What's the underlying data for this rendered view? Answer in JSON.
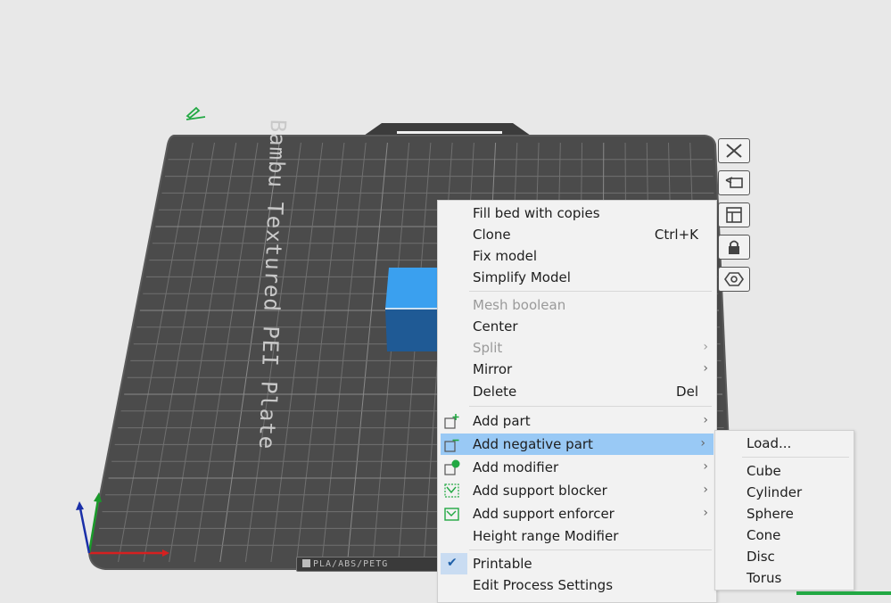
{
  "viewport": {
    "plate_label": "Bambu Textured PEI Plate",
    "plate_badge": "PLA/ABS/PETG",
    "colors": {
      "plate": "#4b4b4b",
      "grid": "#6e6e6e",
      "cube_top": "#3aa0ef",
      "cube_side": "#1f5a95",
      "axis_x": "#d62020",
      "axis_y": "#1a9a2a",
      "axis_z": "#1a2fa8"
    }
  },
  "toolbar_right": {
    "icons": [
      "close-icon",
      "arrange-icon",
      "layout-icon",
      "lock-icon",
      "hexagon-icon"
    ]
  },
  "context_menu": {
    "fill_bed": "Fill bed with copies",
    "clone": "Clone",
    "clone_shortcut": "Ctrl+K",
    "fix_model": "Fix model",
    "simplify_model": "Simplify Model",
    "mesh_boolean": "Mesh boolean",
    "center": "Center",
    "split": "Split",
    "mirror": "Mirror",
    "delete": "Delete",
    "delete_shortcut": "Del",
    "add_part": "Add part",
    "add_negative_part": "Add negative part",
    "add_modifier": "Add modifier",
    "add_support_blocker": "Add support blocker",
    "add_support_enforcer": "Add support enforcer",
    "height_range_modifier": "Height range Modifier",
    "printable": "Printable",
    "edit_process_settings": "Edit Process Settings",
    "submenu_arrow": "›",
    "check": "✔"
  },
  "submenu": {
    "load": "Load...",
    "cube": "Cube",
    "cylinder": "Cylinder",
    "sphere": "Sphere",
    "cone": "Cone",
    "disc": "Disc",
    "torus": "Torus"
  }
}
